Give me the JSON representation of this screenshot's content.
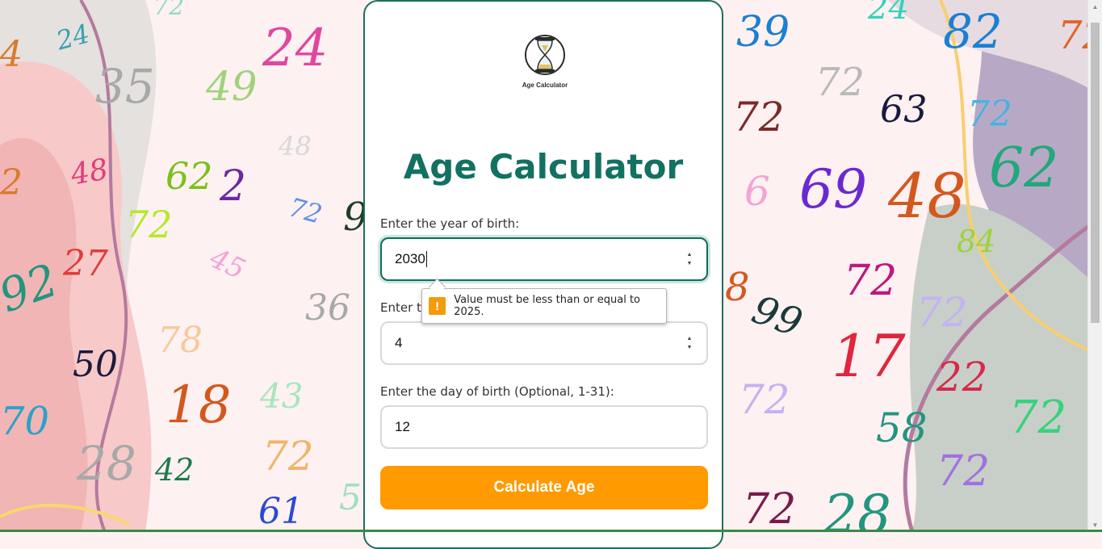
{
  "app": {
    "logo_caption": "Age Calculator",
    "title": "Age Calculator"
  },
  "form": {
    "year_label": "Enter the year of birth:",
    "year_value": "2030",
    "month_label": "Enter the month of birth (1-12):",
    "month_value": "4",
    "day_label": "Enter the day of birth (Optional, 1-31):",
    "day_value": "12",
    "calculate_label": "Calculate Age"
  },
  "validation": {
    "message": "Value must be less than or equal to 2025.",
    "icon": "warning-icon"
  },
  "colors": {
    "accent": "#137162",
    "button": "#ff9a00",
    "warning": "#f49b0b"
  },
  "background_numbers": [
    "24",
    "35",
    "49",
    "24",
    "72",
    "48",
    "62",
    "2",
    "72",
    "48",
    "72",
    "45",
    "27",
    "92",
    "36",
    "78",
    "50",
    "18",
    "43",
    "28",
    "42",
    "72",
    "61",
    "70",
    "39",
    "72",
    "72",
    "63",
    "82",
    "72",
    "6",
    "69",
    "48",
    "62",
    "84",
    "8",
    "72",
    "99",
    "72",
    "17",
    "22",
    "72",
    "72",
    "58",
    "72",
    "72",
    "28",
    "24",
    "72",
    "4",
    "2",
    "5",
    "9"
  ]
}
